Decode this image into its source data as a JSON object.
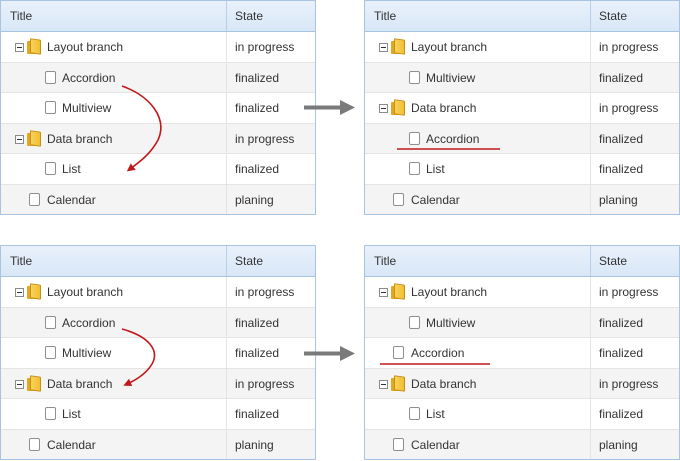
{
  "colors": {
    "header_bg": "#dce9f7",
    "border": "#a8c4e0",
    "alt_row": "#f4f4f4",
    "drag_arrow": "#c0181b",
    "underline": "#c0181b",
    "transition_arrow": "#7a7a7a"
  },
  "icons": {
    "branch": "folder-icon",
    "leaf": "file-icon",
    "toggle": "collapse-minus-icon"
  },
  "panels": {
    "top_left": {
      "header": {
        "title": "Title",
        "state": "State"
      },
      "rows": [
        {
          "title": "Layout branch",
          "state": "in progress"
        },
        {
          "title": "Accordion",
          "state": "finalized"
        },
        {
          "title": "Multiview",
          "state": "finalized"
        },
        {
          "title": "Data branch",
          "state": "in progress"
        },
        {
          "title": "List",
          "state": "finalized"
        },
        {
          "title": "Calendar",
          "state": "planing"
        }
      ]
    },
    "top_right": {
      "header": {
        "title": "Title",
        "state": "State"
      },
      "rows": [
        {
          "title": "Layout branch",
          "state": "in progress"
        },
        {
          "title": "Multiview",
          "state": "finalized"
        },
        {
          "title": "Data branch",
          "state": "in progress"
        },
        {
          "title": "Accordion",
          "state": "finalized"
        },
        {
          "title": "List",
          "state": "finalized"
        },
        {
          "title": "Calendar",
          "state": "planing"
        }
      ]
    },
    "bottom_left": {
      "header": {
        "title": "Title",
        "state": "State"
      },
      "rows": [
        {
          "title": "Layout branch",
          "state": "in progress"
        },
        {
          "title": "Accordion",
          "state": "finalized"
        },
        {
          "title": "Multiview",
          "state": "finalized"
        },
        {
          "title": "Data branch",
          "state": "in progress"
        },
        {
          "title": "List",
          "state": "finalized"
        },
        {
          "title": "Calendar",
          "state": "planing"
        }
      ]
    },
    "bottom_right": {
      "header": {
        "title": "Title",
        "state": "State"
      },
      "rows": [
        {
          "title": "Layout branch",
          "state": "in progress"
        },
        {
          "title": "Multiview",
          "state": "finalized"
        },
        {
          "title": "Accordion",
          "state": "finalized"
        },
        {
          "title": "Data branch",
          "state": "in progress"
        },
        {
          "title": "List",
          "state": "finalized"
        },
        {
          "title": "Calendar",
          "state": "planing"
        }
      ]
    }
  }
}
